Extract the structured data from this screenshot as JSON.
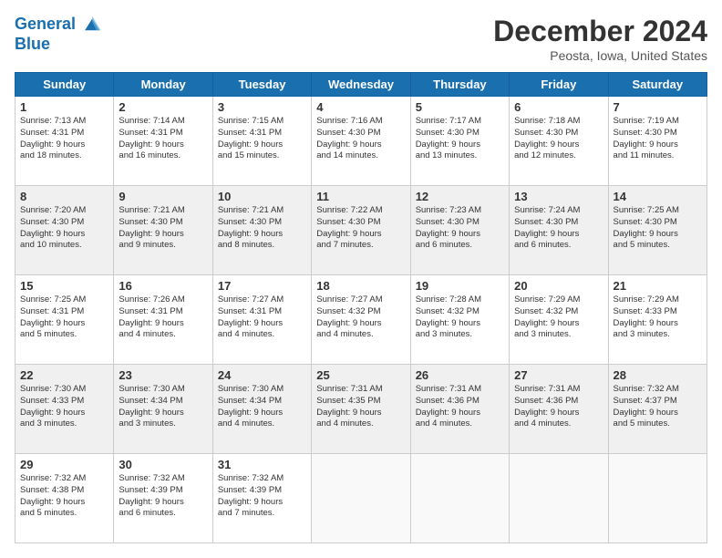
{
  "header": {
    "logo_line1": "General",
    "logo_line2": "Blue",
    "month_title": "December 2024",
    "location": "Peosta, Iowa, United States"
  },
  "weekdays": [
    "Sunday",
    "Monday",
    "Tuesday",
    "Wednesday",
    "Thursday",
    "Friday",
    "Saturday"
  ],
  "weeks": [
    [
      {
        "day": "1",
        "detail": "Sunrise: 7:13 AM\nSunset: 4:31 PM\nDaylight: 9 hours\nand 18 minutes."
      },
      {
        "day": "2",
        "detail": "Sunrise: 7:14 AM\nSunset: 4:31 PM\nDaylight: 9 hours\nand 16 minutes."
      },
      {
        "day": "3",
        "detail": "Sunrise: 7:15 AM\nSunset: 4:31 PM\nDaylight: 9 hours\nand 15 minutes."
      },
      {
        "day": "4",
        "detail": "Sunrise: 7:16 AM\nSunset: 4:30 PM\nDaylight: 9 hours\nand 14 minutes."
      },
      {
        "day": "5",
        "detail": "Sunrise: 7:17 AM\nSunset: 4:30 PM\nDaylight: 9 hours\nand 13 minutes."
      },
      {
        "day": "6",
        "detail": "Sunrise: 7:18 AM\nSunset: 4:30 PM\nDaylight: 9 hours\nand 12 minutes."
      },
      {
        "day": "7",
        "detail": "Sunrise: 7:19 AM\nSunset: 4:30 PM\nDaylight: 9 hours\nand 11 minutes."
      }
    ],
    [
      {
        "day": "8",
        "detail": "Sunrise: 7:20 AM\nSunset: 4:30 PM\nDaylight: 9 hours\nand 10 minutes."
      },
      {
        "day": "9",
        "detail": "Sunrise: 7:21 AM\nSunset: 4:30 PM\nDaylight: 9 hours\nand 9 minutes."
      },
      {
        "day": "10",
        "detail": "Sunrise: 7:21 AM\nSunset: 4:30 PM\nDaylight: 9 hours\nand 8 minutes."
      },
      {
        "day": "11",
        "detail": "Sunrise: 7:22 AM\nSunset: 4:30 PM\nDaylight: 9 hours\nand 7 minutes."
      },
      {
        "day": "12",
        "detail": "Sunrise: 7:23 AM\nSunset: 4:30 PM\nDaylight: 9 hours\nand 6 minutes."
      },
      {
        "day": "13",
        "detail": "Sunrise: 7:24 AM\nSunset: 4:30 PM\nDaylight: 9 hours\nand 6 minutes."
      },
      {
        "day": "14",
        "detail": "Sunrise: 7:25 AM\nSunset: 4:30 PM\nDaylight: 9 hours\nand 5 minutes."
      }
    ],
    [
      {
        "day": "15",
        "detail": "Sunrise: 7:25 AM\nSunset: 4:31 PM\nDaylight: 9 hours\nand 5 minutes."
      },
      {
        "day": "16",
        "detail": "Sunrise: 7:26 AM\nSunset: 4:31 PM\nDaylight: 9 hours\nand 4 minutes."
      },
      {
        "day": "17",
        "detail": "Sunrise: 7:27 AM\nSunset: 4:31 PM\nDaylight: 9 hours\nand 4 minutes."
      },
      {
        "day": "18",
        "detail": "Sunrise: 7:27 AM\nSunset: 4:32 PM\nDaylight: 9 hours\nand 4 minutes."
      },
      {
        "day": "19",
        "detail": "Sunrise: 7:28 AM\nSunset: 4:32 PM\nDaylight: 9 hours\nand 3 minutes."
      },
      {
        "day": "20",
        "detail": "Sunrise: 7:29 AM\nSunset: 4:32 PM\nDaylight: 9 hours\nand 3 minutes."
      },
      {
        "day": "21",
        "detail": "Sunrise: 7:29 AM\nSunset: 4:33 PM\nDaylight: 9 hours\nand 3 minutes."
      }
    ],
    [
      {
        "day": "22",
        "detail": "Sunrise: 7:30 AM\nSunset: 4:33 PM\nDaylight: 9 hours\nand 3 minutes."
      },
      {
        "day": "23",
        "detail": "Sunrise: 7:30 AM\nSunset: 4:34 PM\nDaylight: 9 hours\nand 3 minutes."
      },
      {
        "day": "24",
        "detail": "Sunrise: 7:30 AM\nSunset: 4:34 PM\nDaylight: 9 hours\nand 4 minutes."
      },
      {
        "day": "25",
        "detail": "Sunrise: 7:31 AM\nSunset: 4:35 PM\nDaylight: 9 hours\nand 4 minutes."
      },
      {
        "day": "26",
        "detail": "Sunrise: 7:31 AM\nSunset: 4:36 PM\nDaylight: 9 hours\nand 4 minutes."
      },
      {
        "day": "27",
        "detail": "Sunrise: 7:31 AM\nSunset: 4:36 PM\nDaylight: 9 hours\nand 4 minutes."
      },
      {
        "day": "28",
        "detail": "Sunrise: 7:32 AM\nSunset: 4:37 PM\nDaylight: 9 hours\nand 5 minutes."
      }
    ],
    [
      {
        "day": "29",
        "detail": "Sunrise: 7:32 AM\nSunset: 4:38 PM\nDaylight: 9 hours\nand 5 minutes."
      },
      {
        "day": "30",
        "detail": "Sunrise: 7:32 AM\nSunset: 4:39 PM\nDaylight: 9 hours\nand 6 minutes."
      },
      {
        "day": "31",
        "detail": "Sunrise: 7:32 AM\nSunset: 4:39 PM\nDaylight: 9 hours\nand 7 minutes."
      },
      {
        "day": "",
        "detail": ""
      },
      {
        "day": "",
        "detail": ""
      },
      {
        "day": "",
        "detail": ""
      },
      {
        "day": "",
        "detail": ""
      }
    ]
  ]
}
